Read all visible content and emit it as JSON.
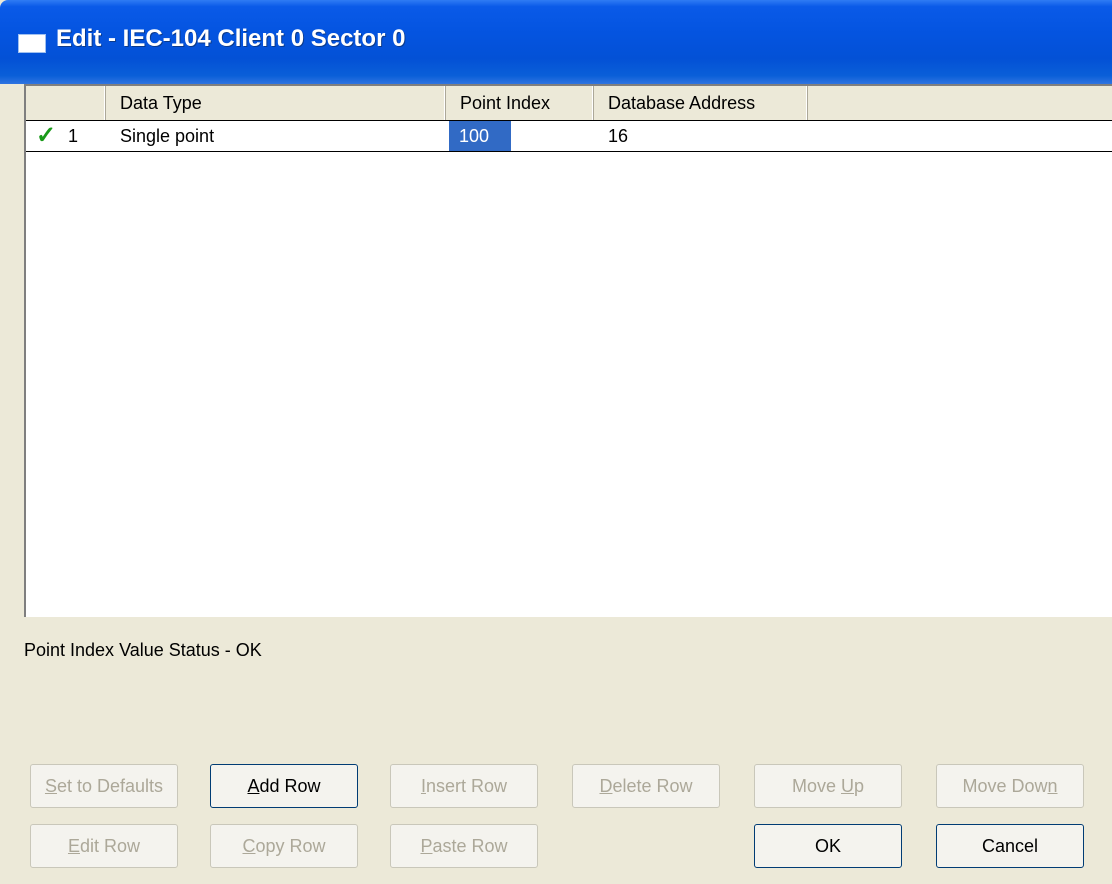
{
  "window": {
    "title": "Edit - IEC-104 Client 0 Sector 0"
  },
  "grid": {
    "columns": [
      "",
      "Data Type",
      "Point Index",
      "Database Address"
    ],
    "rows": [
      {
        "status_icon": "check-icon",
        "row_number": "1",
        "data_type": "Single point",
        "point_index": "100",
        "database_address": "16"
      }
    ]
  },
  "status_text": "Point Index Value Status - OK",
  "buttons": {
    "set_defaults": {
      "pre": "",
      "u": "S",
      "post": "et to Defaults"
    },
    "add_row": {
      "pre": "",
      "u": "A",
      "post": "dd Row"
    },
    "insert_row": {
      "pre": "",
      "u": "I",
      "post": "nsert Row"
    },
    "delete_row": {
      "pre": "",
      "u": "D",
      "post": "elete Row"
    },
    "move_up": {
      "pre": "Move ",
      "u": "U",
      "post": "p"
    },
    "move_down": {
      "pre": "Move Dow",
      "u": "n",
      "post": ""
    },
    "edit_row": {
      "pre": "",
      "u": "E",
      "post": "dit Row"
    },
    "copy_row": {
      "pre": "",
      "u": "C",
      "post": "opy Row"
    },
    "paste_row": {
      "pre": "",
      "u": "P",
      "post": "aste Row"
    },
    "ok": "OK",
    "cancel": "Cancel"
  },
  "colors": {
    "titlebar": "#0454e0",
    "selection": "#316ac5",
    "check": "#1a9a1a",
    "dialog_bg": "#ece9d8"
  }
}
